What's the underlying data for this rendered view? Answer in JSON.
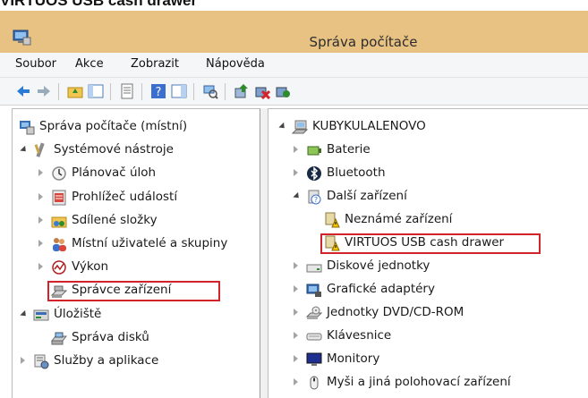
{
  "page_heading": "VIRTUOS USB cash drawer",
  "window": {
    "title": "Správa počítače"
  },
  "menu": [
    "Soubor",
    "Akce",
    "Zobrazit",
    "Nápověda"
  ],
  "left_tree": [
    {
      "label": "Správa počítače (místní)",
      "icon": "computer-management-icon",
      "expander": "none"
    },
    {
      "label": "Systémové nástroje",
      "icon": "tools-icon",
      "expander": "open"
    },
    {
      "label": "Plánovač úloh",
      "icon": "clock-icon",
      "expander": "closed"
    },
    {
      "label": "Prohlížeč událostí",
      "icon": "event-viewer-icon",
      "expander": "closed"
    },
    {
      "label": "Sdílené složky",
      "icon": "shared-folder-icon",
      "expander": "closed"
    },
    {
      "label": "Místní uživatelé a skupiny",
      "icon": "users-icon",
      "expander": "closed"
    },
    {
      "label": "Výkon",
      "icon": "performance-icon",
      "expander": "closed"
    },
    {
      "label": "Správce zařízení",
      "icon": "device-manager-icon",
      "expander": "none",
      "highlighted": true
    },
    {
      "label": "Úložiště",
      "icon": "storage-icon",
      "expander": "open"
    },
    {
      "label": "Správa disků",
      "icon": "disk-icon",
      "expander": "none"
    },
    {
      "label": "Služby a aplikace",
      "icon": "services-icon",
      "expander": "closed"
    }
  ],
  "right_tree": [
    {
      "label": "KUBYKULALENOVO",
      "icon": "computer-icon",
      "expander": "open"
    },
    {
      "label": "Baterie",
      "icon": "battery-icon",
      "expander": "closed"
    },
    {
      "label": "Bluetooth",
      "icon": "bluetooth-icon",
      "expander": "closed"
    },
    {
      "label": "Další zařízení",
      "icon": "other-devices-icon",
      "expander": "open"
    },
    {
      "label": "Neznámé zařízení",
      "icon": "warning-device-icon",
      "expander": "none"
    },
    {
      "label": "VIRTUOS USB cash drawer",
      "icon": "warning-device-icon",
      "expander": "none",
      "highlighted": true
    },
    {
      "label": "Diskové jednotky",
      "icon": "drive-icon",
      "expander": "closed"
    },
    {
      "label": "Grafické adaptéry",
      "icon": "display-adapter-icon",
      "expander": "closed"
    },
    {
      "label": "Jednotky DVD/CD-ROM",
      "icon": "dvd-icon",
      "expander": "closed"
    },
    {
      "label": "Klávesnice",
      "icon": "keyboard-icon",
      "expander": "closed"
    },
    {
      "label": "Monitory",
      "icon": "monitor-icon",
      "expander": "closed"
    },
    {
      "label": "Myši a jiná polohovací zařízení",
      "icon": "mouse-icon",
      "expander": "closed"
    }
  ],
  "colors": {
    "titlebar": "#e8c283",
    "highlight": "#d2232a"
  }
}
